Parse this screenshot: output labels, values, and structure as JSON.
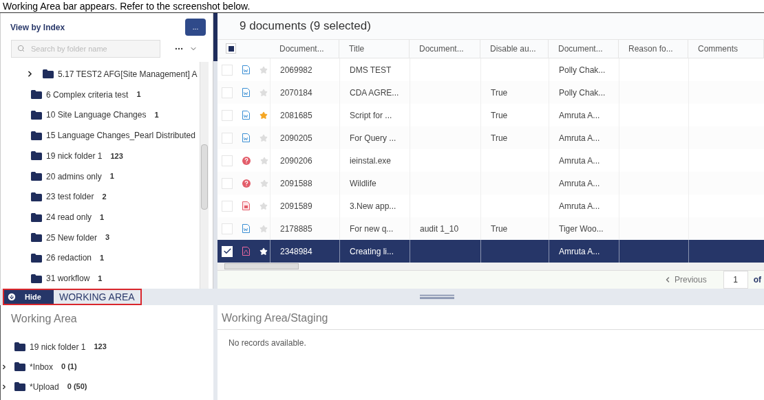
{
  "caption": "Working Area bar appears. Refer to the screenshot below.",
  "index_panel": {
    "title": "View by Index",
    "menu_button": "...",
    "search": {
      "placeholder": "Search by folder name"
    },
    "folders": [
      {
        "name": "5.17 TEST2 AFG[Site Management] A",
        "expandable": true
      },
      {
        "name": "6 Complex criteria test",
        "count": "1",
        "expandable": false
      },
      {
        "name": "10 Site Language Changes",
        "count": "1",
        "expandable": false
      },
      {
        "name": "15 Language Changes_Pearl Distributed",
        "expandable": false
      },
      {
        "name": "19 nick folder 1",
        "count": "123",
        "expandable": false
      },
      {
        "name": "20 admins only",
        "count": "1",
        "expandable": false
      },
      {
        "name": "23 test folder",
        "count": "2",
        "expandable": false
      },
      {
        "name": "24 read only",
        "count": "1",
        "expandable": false
      },
      {
        "name": "25 New folder",
        "count": "3",
        "expandable": false
      },
      {
        "name": "26 redaction",
        "count": "1",
        "expandable": false
      },
      {
        "name": "31 workflow",
        "count": "1",
        "expandable": false
      }
    ]
  },
  "documents": {
    "title": "9 documents (9 selected)",
    "select_all_partial": true,
    "columns": [
      "Document...",
      "Title",
      "Document...",
      "Disable au...",
      "Document...",
      "Reason fo...",
      "Comments"
    ],
    "rows": [
      {
        "selected": false,
        "kind": "word",
        "starred": false,
        "cells": [
          "2069982",
          "DMS TEST",
          "",
          "",
          "Polly Chak...",
          "",
          ""
        ]
      },
      {
        "selected": false,
        "kind": "word",
        "starred": false,
        "cells": [
          "2070184",
          "CDA AGRE...",
          "",
          "True",
          "Polly Chak...",
          "",
          ""
        ]
      },
      {
        "selected": false,
        "kind": "word",
        "starred": true,
        "cells": [
          "2081685",
          "Script for ...",
          "",
          "True",
          "Amruta A...",
          "",
          ""
        ]
      },
      {
        "selected": false,
        "kind": "word",
        "starred": false,
        "cells": [
          "2090205",
          "For Query ...",
          "",
          "True",
          "Amruta A...",
          "",
          ""
        ]
      },
      {
        "selected": false,
        "kind": "unknown",
        "starred": false,
        "cells": [
          "2090206",
          "ieinstal.exe",
          "",
          "",
          "Amruta A...",
          "",
          ""
        ]
      },
      {
        "selected": false,
        "kind": "unknown",
        "starred": false,
        "cells": [
          "2091588",
          "Wildlife",
          "",
          "",
          "Amruta A...",
          "",
          ""
        ]
      },
      {
        "selected": false,
        "kind": "media",
        "starred": false,
        "cells": [
          "2091589",
          "3.New app...",
          "",
          "",
          "Amruta A...",
          "",
          ""
        ]
      },
      {
        "selected": false,
        "kind": "word",
        "starred": false,
        "cells": [
          "2178885",
          "For new q...",
          "audit 1_10",
          "True",
          "Tiger Woo...",
          "",
          ""
        ]
      },
      {
        "selected": true,
        "kind": "pdf",
        "starred": false,
        "cells": [
          "2348984",
          "Creating li...",
          "",
          "",
          "Amruta A...",
          "",
          ""
        ]
      }
    ],
    "pager": {
      "previous": "Previous",
      "page": "1",
      "of": "of"
    }
  },
  "working_bar": {
    "hide_button": "Hide",
    "label": "WORKING AREA"
  },
  "working_area": {
    "title": "Working Area",
    "folders": [
      {
        "name": "19 nick folder 1",
        "count": "123",
        "expandable": false
      },
      {
        "name": "*Inbox",
        "count": "0 (1)",
        "expandable": true
      },
      {
        "name": "*Upload",
        "count": "0 (50)",
        "expandable": true
      }
    ]
  },
  "staging": {
    "title": "Working Area/Staging",
    "empty_text": "No records available."
  }
}
